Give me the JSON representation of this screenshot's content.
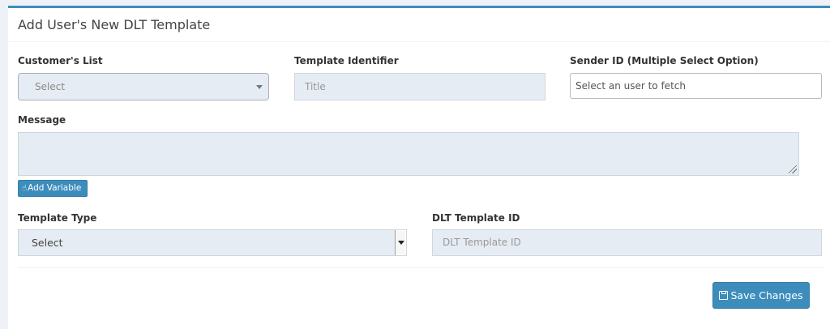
{
  "panel": {
    "title": "Add User's New DLT Template"
  },
  "customers_list": {
    "label": "Customer's List",
    "selected": "Select"
  },
  "template_identifier": {
    "label": "Template Identifier",
    "placeholder": "Title"
  },
  "sender_id": {
    "label": "Sender ID (Multiple Select Option)",
    "placeholder": "Select an user to fetch"
  },
  "message": {
    "label": "Message",
    "value": ""
  },
  "add_variable": {
    "label": "Add Variable",
    "icon": "hand-pointer-icon"
  },
  "template_type": {
    "label": "Template Type",
    "selected": "Select"
  },
  "dlt_template_id": {
    "label": "DLT Template ID",
    "placeholder": "DLT Template ID"
  },
  "save": {
    "label": "Save Changes",
    "icon": "floppy-disk-icon"
  },
  "colors": {
    "accent": "#3c8dbc",
    "field_bg": "#e6ecf3",
    "page_bg": "#eef1f5"
  }
}
